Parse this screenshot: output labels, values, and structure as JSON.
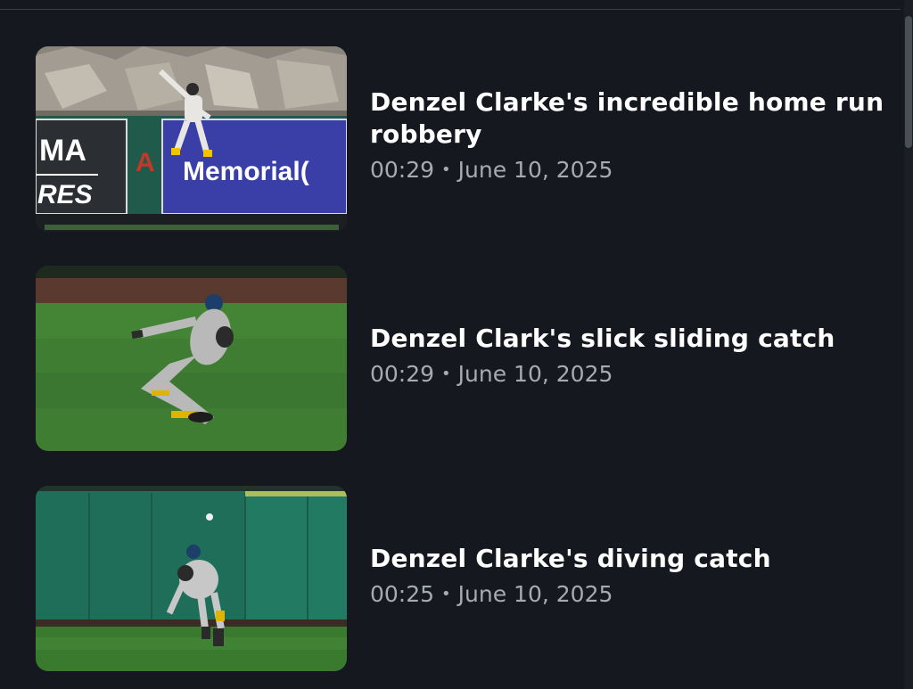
{
  "videos": [
    {
      "title": "Denzel Clarke's incredible home run robbery",
      "duration": "00:29",
      "separator": "•",
      "date": "June 10, 2025",
      "thumbnail_icon": "home-run-robbery-thumbnail",
      "thumbnail_text": [
        "MA",
        "RES",
        "Memorial("
      ]
    },
    {
      "title": "Denzel Clark's slick sliding catch",
      "duration": "00:29",
      "separator": "•",
      "date": "June 10, 2025",
      "thumbnail_icon": "sliding-catch-thumbnail"
    },
    {
      "title": "Denzel Clarke's diving catch",
      "duration": "00:25",
      "separator": "•",
      "date": "June 10, 2025",
      "thumbnail_icon": "diving-catch-thumbnail"
    }
  ],
  "colors": {
    "background": "#15191f",
    "title": "#ffffff",
    "subline": "#a7abb1"
  }
}
